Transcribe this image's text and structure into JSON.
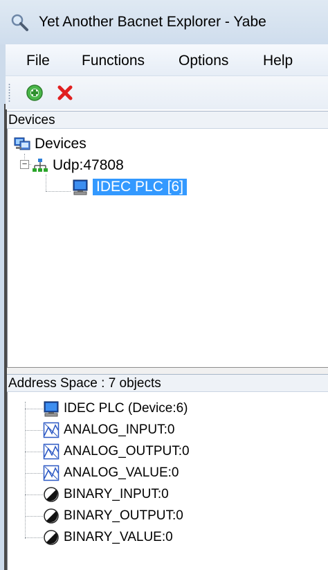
{
  "window": {
    "title": "Yet Another Bacnet Explorer - Yabe"
  },
  "menu": {
    "items": [
      "File",
      "Functions",
      "Options",
      "Help"
    ]
  },
  "toolbar": {
    "add_icon": "add-circle-icon",
    "remove_icon": "red-x-icon"
  },
  "devices_panel": {
    "header": "Devices",
    "tree": {
      "root": {
        "label": "Devices",
        "icon": "devices-network-icon"
      },
      "transport": {
        "label": "Udp:47808",
        "icon": "network-topology-icon",
        "expanded": true
      },
      "device": {
        "label": "IDEC PLC [6]",
        "icon": "computer-icon",
        "selected": true
      }
    }
  },
  "address_panel": {
    "header": "Address Space : 7 objects",
    "objects": [
      {
        "label": "IDEC PLC (Device:6)",
        "icon": "computer-icon"
      },
      {
        "label": "ANALOG_INPUT:0",
        "icon": "analog-chart-icon"
      },
      {
        "label": "ANALOG_OUTPUT:0",
        "icon": "analog-chart-icon"
      },
      {
        "label": "ANALOG_VALUE:0",
        "icon": "analog-chart-icon"
      },
      {
        "label": "BINARY_INPUT:0",
        "icon": "binary-circle-icon"
      },
      {
        "label": "BINARY_OUTPUT:0",
        "icon": "binary-circle-icon"
      },
      {
        "label": "BINARY_VALUE:0",
        "icon": "binary-circle-icon"
      }
    ]
  },
  "colors": {
    "selection": "#3399ff",
    "remove": "#e02020",
    "add": "#3aa83a"
  }
}
